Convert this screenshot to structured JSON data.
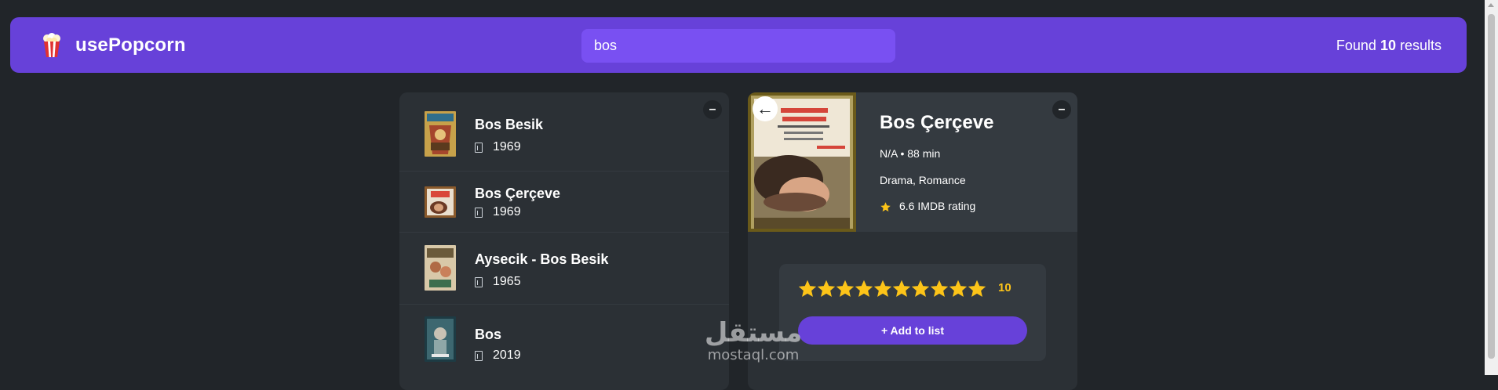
{
  "navbar": {
    "brand": "usePopcorn",
    "search_value": "bos",
    "results_prefix": "Found ",
    "results_count": "10",
    "results_suffix": " results"
  },
  "list": {
    "toggle_label": "–",
    "movies": [
      {
        "title": "Bos Besik",
        "year": "1969"
      },
      {
        "title": "Bos Çerçeve",
        "year": "1969"
      },
      {
        "title": "Aysecik - Bos Besik",
        "year": "1965"
      },
      {
        "title": "Bos",
        "year": "2019"
      }
    ]
  },
  "details": {
    "toggle_label": "–",
    "back_label": "←",
    "title": "Bos Çerçeve",
    "meta": "N/A • 88 min",
    "genre": "Drama, Romance",
    "rating_text": "6.6 IMDB rating",
    "user_rating": "10",
    "add_button": "+ Add to list"
  },
  "watermark": {
    "arabic": "مستقل",
    "latin": "mostaql.com"
  },
  "colors": {
    "background": "#212529",
    "primary": "#6741d9",
    "primary_light": "#7950f2",
    "box": "#2b3035",
    "star": "#fcc419"
  },
  "icons": {
    "logo": "popcorn-icon",
    "year": "calendar-icon",
    "rating": "star-icon"
  }
}
